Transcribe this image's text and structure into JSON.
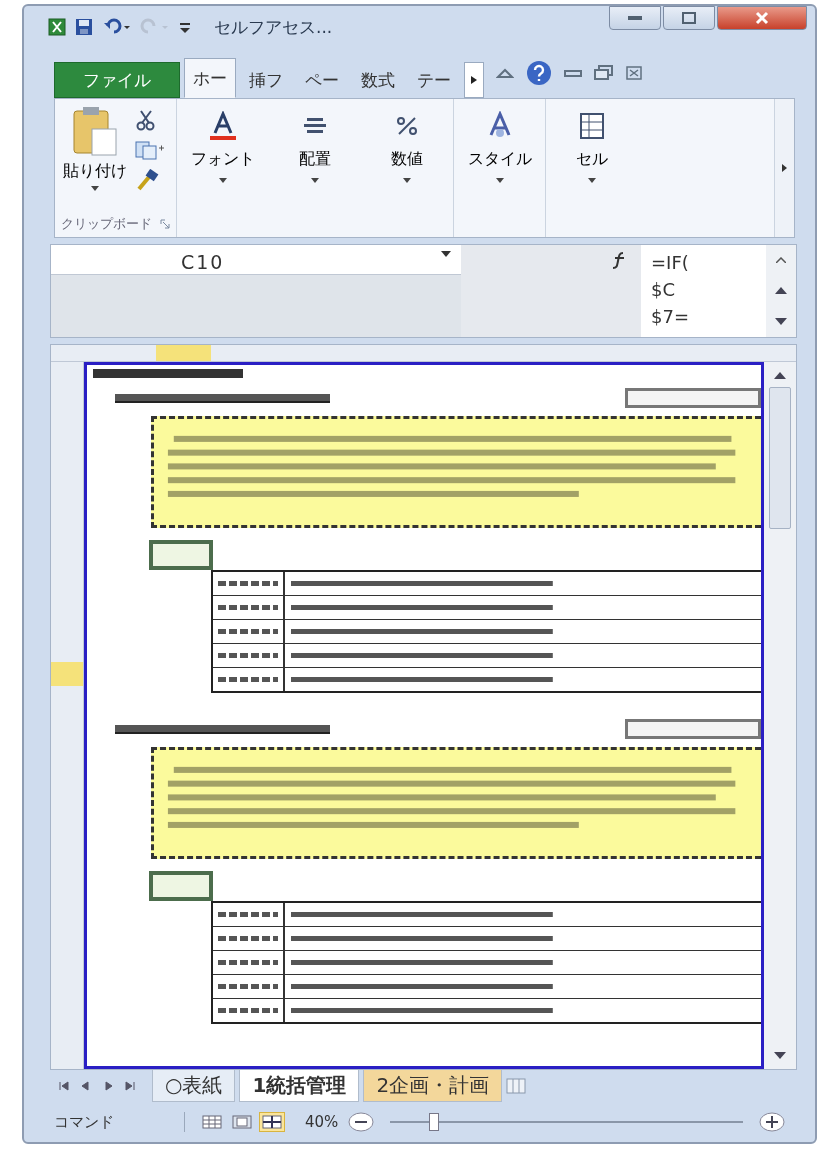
{
  "window": {
    "title": "セルフアセス..."
  },
  "ribbon_tabs": [
    {
      "label": "ファイル",
      "kind": "file",
      "selected": false
    },
    {
      "label": "ホー",
      "kind": "tab",
      "selected": true
    },
    {
      "label": "挿フ",
      "kind": "tab",
      "selected": false
    },
    {
      "label": "ペー",
      "kind": "tab",
      "selected": false
    },
    {
      "label": "数式",
      "kind": "tab",
      "selected": false
    },
    {
      "label": "テー",
      "kind": "tab",
      "selected": false
    }
  ],
  "ribbon": {
    "paste": "貼り付け",
    "clipboard_group": "クリップボード",
    "groups": [
      {
        "label": "フォント",
        "kind": "font"
      },
      {
        "label": "配置",
        "kind": "align"
      },
      {
        "label": "数値",
        "kind": "number"
      },
      {
        "label": "スタイル",
        "kind": "style"
      },
      {
        "label": "セル",
        "kind": "cells"
      }
    ]
  },
  "formula_bar": {
    "name_box": "C10",
    "formula_lines": [
      "=IF(",
      "$C",
      "$7="
    ]
  },
  "sheet": {
    "sections": [
      {
        "rows": [
          {},
          {},
          {},
          {},
          {}
        ]
      },
      {
        "rows": [
          {},
          {},
          {},
          {},
          {}
        ]
      }
    ]
  },
  "sheet_tabs": [
    {
      "label": "○表紙",
      "selected": false,
      "color": "#e6edf6"
    },
    {
      "label": "1統括管理",
      "selected": true,
      "color": "#ffffff"
    },
    {
      "label": "2企画・計画",
      "selected": false,
      "color": "#f3d79b"
    }
  ],
  "status_bar": {
    "mode": "コマンド",
    "views": [
      {
        "kind": "normal",
        "selected": false
      },
      {
        "kind": "layout",
        "selected": false
      },
      {
        "kind": "pagebreak",
        "selected": true
      }
    ],
    "zoom": "40%",
    "zoom_slider": {
      "level": 0.12
    }
  }
}
